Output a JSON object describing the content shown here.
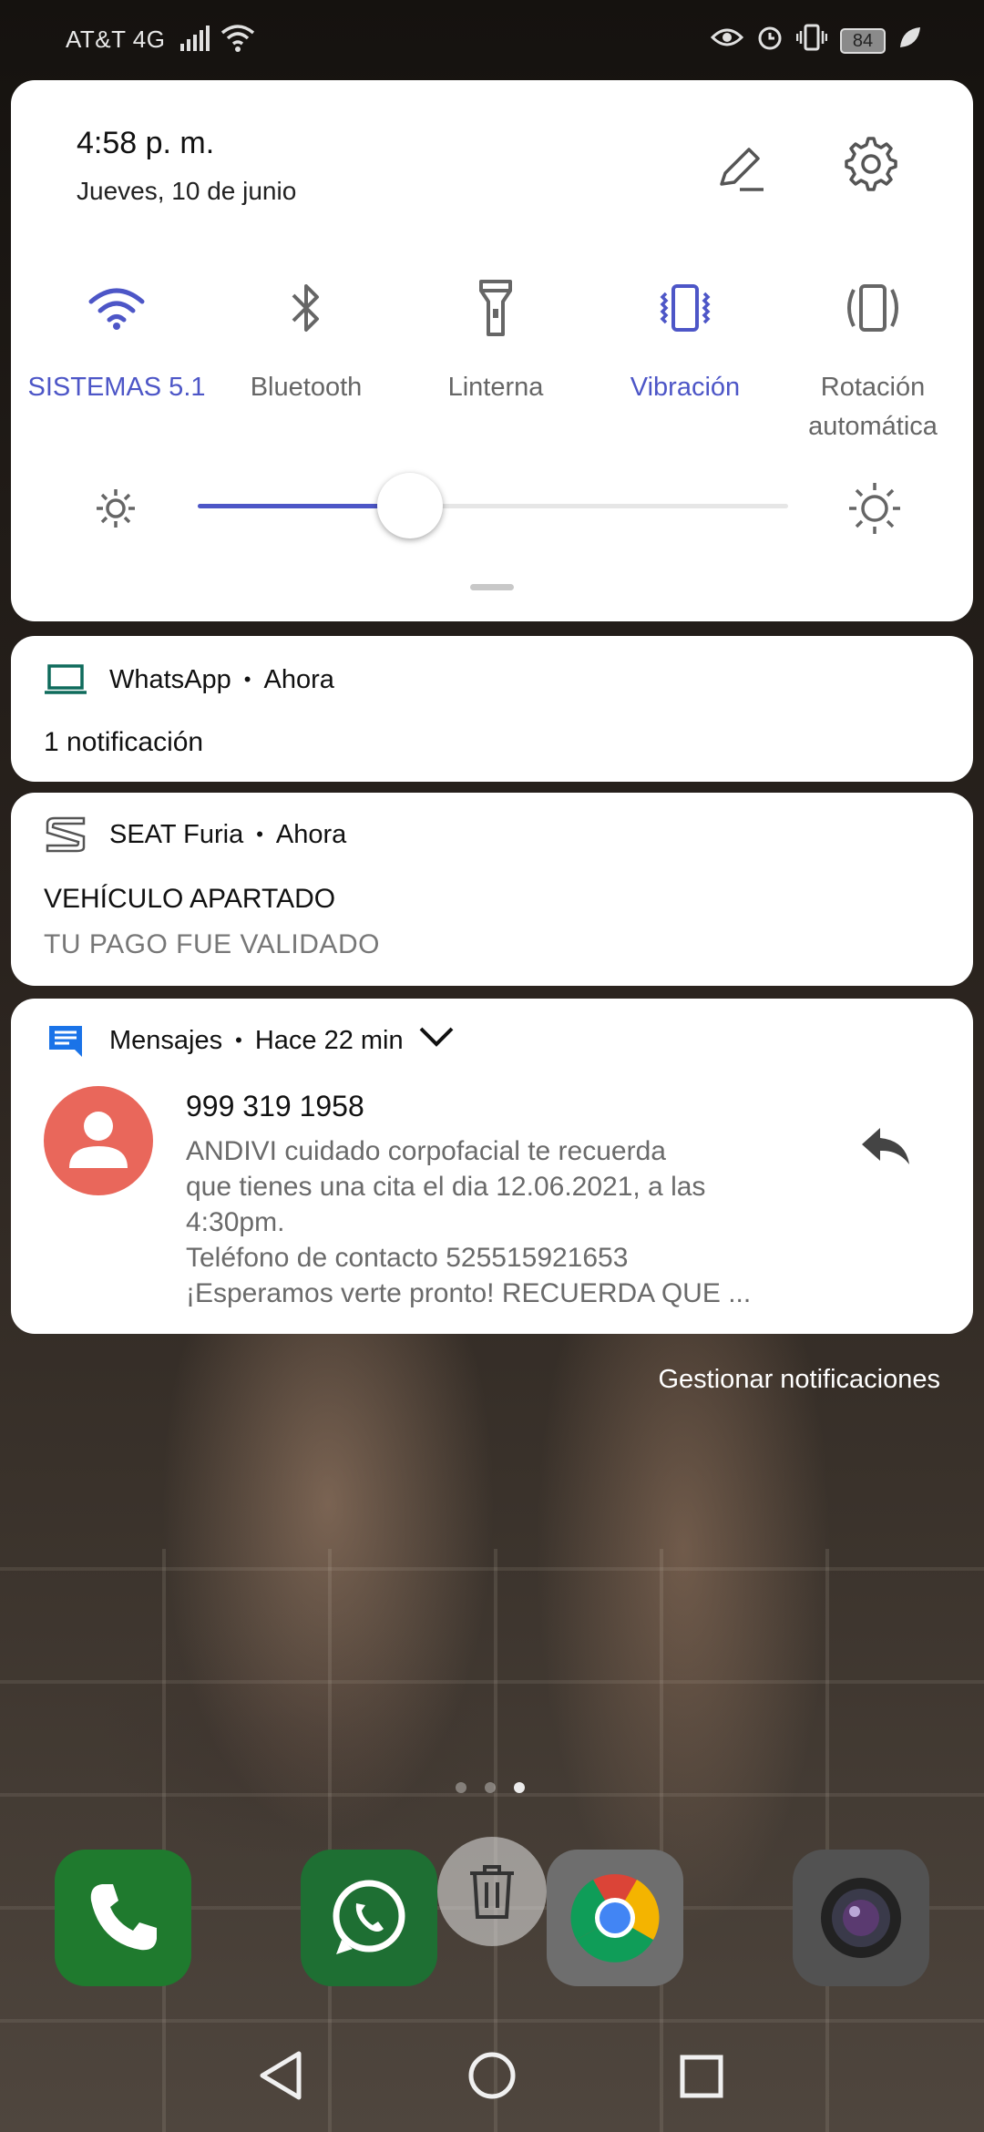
{
  "status_bar": {
    "carrier": "AT&T 4G",
    "battery": "84",
    "icons": [
      "signal-icon",
      "wifi-icon",
      "eye-icon",
      "alarm-icon",
      "vibrate-icon",
      "battery-icon",
      "leaf-icon"
    ]
  },
  "quick_settings": {
    "time": "4:58 p. m.",
    "date": "Jueves, 10 de junio",
    "tiles": [
      {
        "label": "SISTEMAS 5.1",
        "icon": "wifi-icon",
        "active": true
      },
      {
        "label": "Bluetooth",
        "icon": "bluetooth-icon",
        "active": false
      },
      {
        "label": "Linterna",
        "icon": "flashlight-icon",
        "active": false
      },
      {
        "label": "Vibración",
        "icon": "vibrate-icon",
        "active": true
      },
      {
        "label_line1": "Rotación",
        "label_line2": "automática",
        "icon": "rotation-icon",
        "active": false
      }
    ],
    "brightness_level": 0.36,
    "accent_color": "#4d56c7"
  },
  "notifications": [
    {
      "app": "WhatsApp",
      "time": "Ahora",
      "title": "1 notificación",
      "icon": "laptop-icon"
    },
    {
      "app": "SEAT Furia",
      "time": "Ahora",
      "title": "VEHÍCULO APARTADO",
      "subtitle": "TU PAGO FUE VALIDADO",
      "icon": "seat-logo-icon"
    },
    {
      "app": "Mensajes",
      "time": "Hace 22 min",
      "icon": "messages-icon",
      "sender": "999 319 1958",
      "body_lines": [
        "ANDIVI cuidado corpofacial te recuerda",
        "que tienes una cita el dia 12.06.2021, a las",
        "4:30pm.",
        "Teléfono de contacto 525515921653",
        "¡Esperamos verte pronto! RECUERDA QUE ..."
      ],
      "avatar_color": "#e9675b"
    }
  ],
  "manage_label": "Gestionar notificaciones",
  "dock": [
    "phone-app",
    "whatsapp-app",
    "chrome-app",
    "camera-app"
  ],
  "nav": [
    "back-button",
    "home-button",
    "recents-button"
  ]
}
